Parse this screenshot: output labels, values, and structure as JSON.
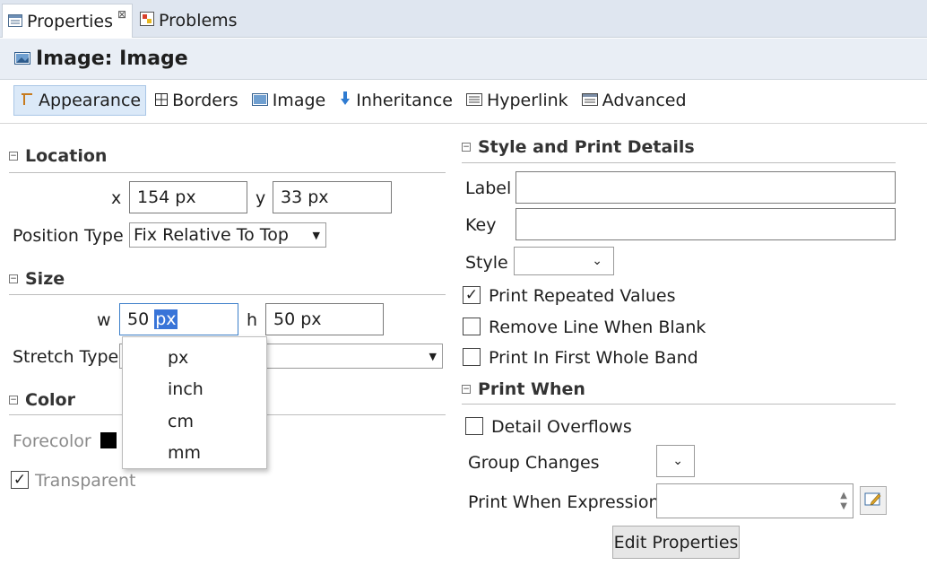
{
  "tabs": [
    {
      "label": "Properties",
      "close": "⊠"
    },
    {
      "label": "Problems"
    }
  ],
  "header": {
    "title": "Image: Image"
  },
  "section_tabs": [
    "Appearance",
    "Borders",
    "Image",
    "Inheritance",
    "Hyperlink",
    "Advanced"
  ],
  "location": {
    "title": "Location",
    "x_label": "x",
    "x_value": "154 px",
    "y_label": "y",
    "y_value": "33 px",
    "position_type_label": "Position Type",
    "position_type_value": "Fix Relative To Top"
  },
  "size": {
    "title": "Size",
    "w_label": "w",
    "w_number": "50 ",
    "w_unit": "px",
    "h_label": "h",
    "h_value": "50 px",
    "stretch_type_label": "Stretch Type"
  },
  "unit_popup": [
    "px",
    "inch",
    "cm",
    "mm"
  ],
  "color": {
    "title": "Color",
    "forecolor_label": "Forecolor",
    "forecolor_hex": "#000000",
    "transparent_label": "Transparent"
  },
  "style_print": {
    "title": "Style and Print Details",
    "label_label": "Label",
    "label_value": "",
    "key_label": "Key",
    "key_value": "",
    "style_label": "Style",
    "print_repeated": "Print Repeated Values",
    "remove_line": "Remove Line When Blank",
    "print_first_band": "Print In First Whole Band"
  },
  "print_when": {
    "title": "Print When",
    "detail_overflows": "Detail Overflows",
    "group_changes": "Group Changes",
    "expression_label": "Print When Expression",
    "edit_button": "Edit Properties"
  }
}
